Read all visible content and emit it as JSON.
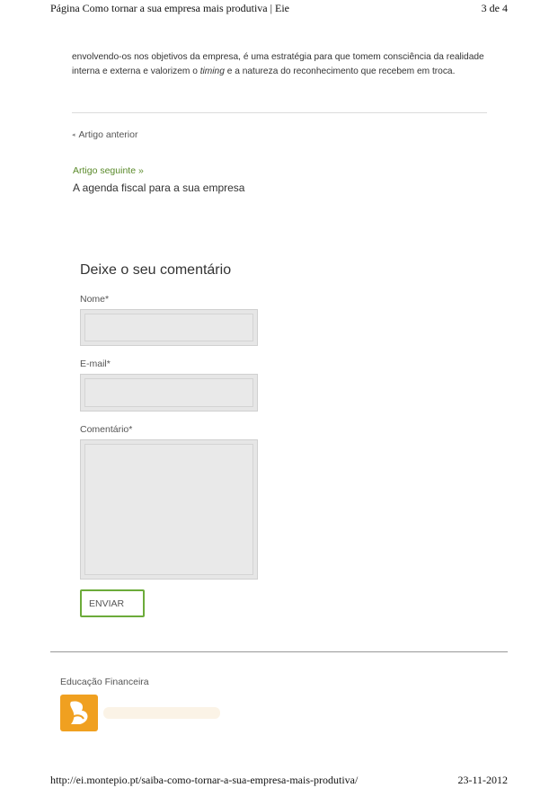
{
  "print_header": {
    "title": "Página Como tornar a sua empresa mais produtiva | Eie",
    "page_counter": "3 de 4"
  },
  "article": {
    "text_before_italic": "envolvendo-os nos objetivos da empresa, é uma estratégia para que tomem consciência da realidade interna e externa e valorizem o ",
    "italic_word": "timing",
    "text_after_italic": " e a natureza do reconhecimento que recebem em troca."
  },
  "navigation": {
    "previous_label": "Artigo anterior",
    "next_label": "Artigo seguinte »",
    "next_title": "A agenda fiscal para a sua empresa"
  },
  "comment_form": {
    "heading": "Deixe o seu comentário",
    "name_label": "Nome*",
    "name_value": "",
    "email_label": "E-mail*",
    "email_value": "",
    "comment_label": "Comentário*",
    "comment_value": "",
    "submit_label": "ENVIAR"
  },
  "footer": {
    "section_title": "Educação Financeira",
    "logo_icon": "educacao-financeira-logo",
    "logo_color": "#f0a020"
  },
  "print_footer": {
    "url": "http://ei.montepio.pt/saiba-como-tornar-a-sua-empresa-mais-produtiva/",
    "date": "23-11-2012"
  }
}
